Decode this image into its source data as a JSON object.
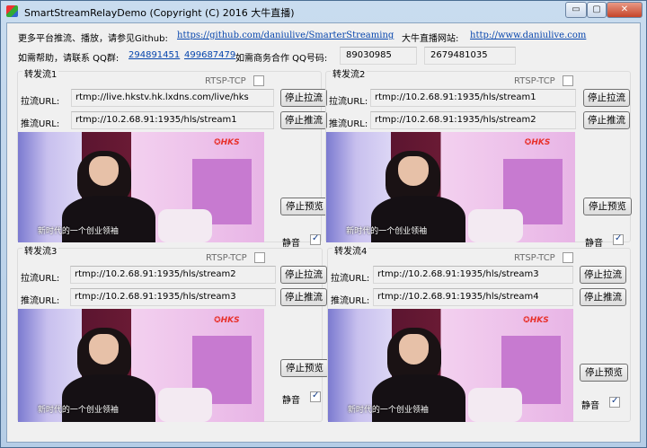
{
  "window": {
    "title": "SmartStreamRelayDemo  (Copyright (C) 2016 大牛直播)",
    "minimize": "▭",
    "maximize": "▢",
    "close": "✕"
  },
  "info": {
    "more_label": "更多平台推流、播放，请参见Github:",
    "github_link": "https://github.com/daniulive/SmarterStreaming",
    "site_label": "大牛直播网站:",
    "site_link": "http://www.daniulive.com",
    "help_label": "如需帮助，请联系 QQ群:",
    "qq_group1": "294891451",
    "qq_group2": "499687479",
    "biz_label": "如需商务合作 QQ号码:",
    "qq1": "89030985",
    "qq2": "2679481035"
  },
  "common": {
    "rtsp_label": "RTSP-TCP",
    "pull_label": "拉流URL:",
    "push_label": "推流URL:",
    "stop_pull": "停止拉流",
    "stop_push": "停止推流",
    "stop_preview": "停止预览",
    "mute_label": "静音",
    "video_logo": "✪HKS",
    "video_caption": "新时代的一个创业领袖"
  },
  "streams": [
    {
      "title": "转发流1",
      "pull_url": "rtmp://live.hkstv.hk.lxdns.com/live/hks",
      "push_url": "rtmp://10.2.68.91:1935/hls/stream1",
      "rtsp_tcp": false,
      "mute": true
    },
    {
      "title": "转发流2",
      "pull_url": "rtmp://10.2.68.91:1935/hls/stream1",
      "push_url": "rtmp://10.2.68.91:1935/hls/stream2",
      "rtsp_tcp": false,
      "mute": true
    },
    {
      "title": "转发流3",
      "pull_url": "rtmp://10.2.68.91:1935/hls/stream2",
      "push_url": "rtmp://10.2.68.91:1935/hls/stream3",
      "rtsp_tcp": false,
      "mute": true
    },
    {
      "title": "转发流4",
      "pull_url": "rtmp://10.2.68.91:1935/hls/stream3",
      "push_url": "rtmp://10.2.68.91:1935/hls/stream4",
      "rtsp_tcp": false,
      "mute": true
    }
  ]
}
